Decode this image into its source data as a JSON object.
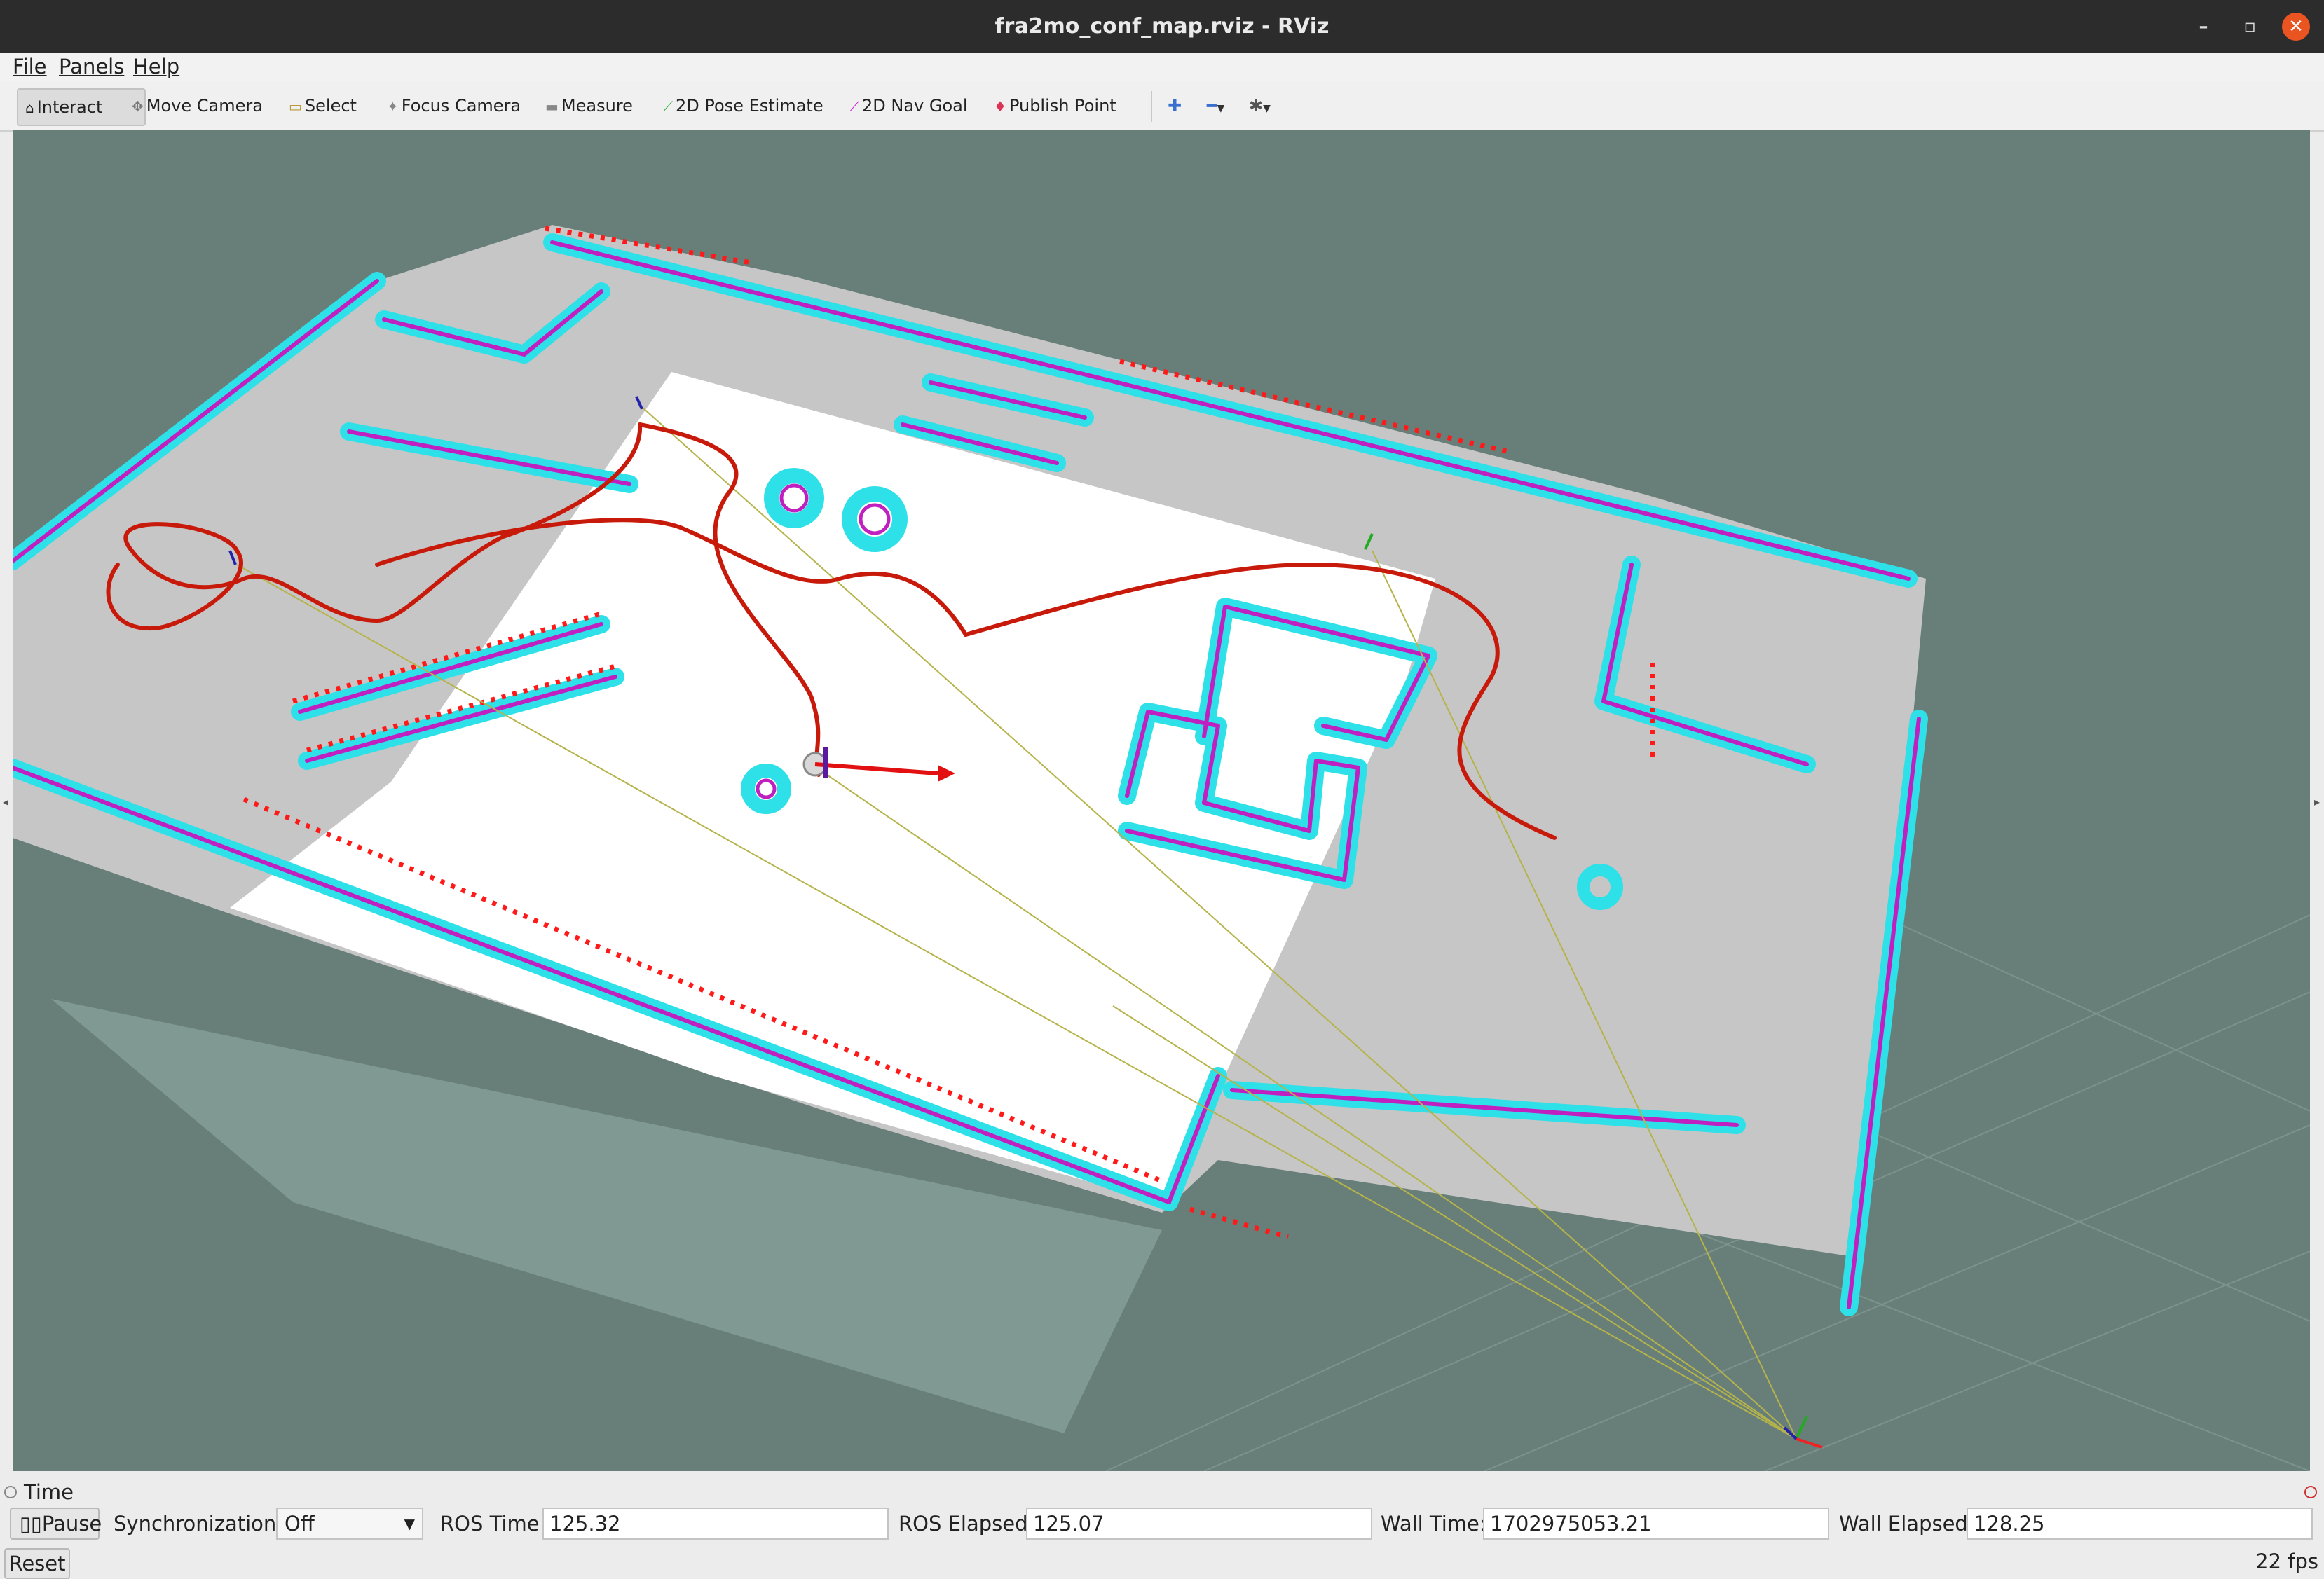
{
  "window": {
    "title": "fra2mo_conf_map.rviz - RViz"
  },
  "menu": {
    "file": "File",
    "panels": "Panels",
    "help": "Help"
  },
  "toolbar": {
    "interact": "Interact",
    "move_camera": "Move Camera",
    "select": "Select",
    "focus_camera": "Focus Camera",
    "measure": "Measure",
    "pose_estimate": "2D Pose Estimate",
    "nav_goal": "2D Nav Goal",
    "publish_point": "Publish Point"
  },
  "time_panel": {
    "title": "Time",
    "pause_label": "Pause",
    "sync_label": "Synchronization:",
    "sync_value": "Off",
    "ros_time_label": "ROS Time:",
    "ros_time": "125.32",
    "ros_elapsed_label": "ROS Elapsed:",
    "ros_elapsed": "125.07",
    "wall_time_label": "Wall Time:",
    "wall_time": "1702975053.21",
    "wall_elapsed_label": "Wall Elapsed:",
    "wall_elapsed": "128.25"
  },
  "status": {
    "reset_label": "Reset",
    "fps": "22 fps"
  },
  "colors": {
    "background": "#687f79",
    "map_known": "#c6c6c6",
    "map_free": "#ffffff",
    "inflation": "#2ee0e8",
    "obstacle": "#cc22cc",
    "path": "#c81a0a",
    "laser": "#ff1a1a"
  }
}
